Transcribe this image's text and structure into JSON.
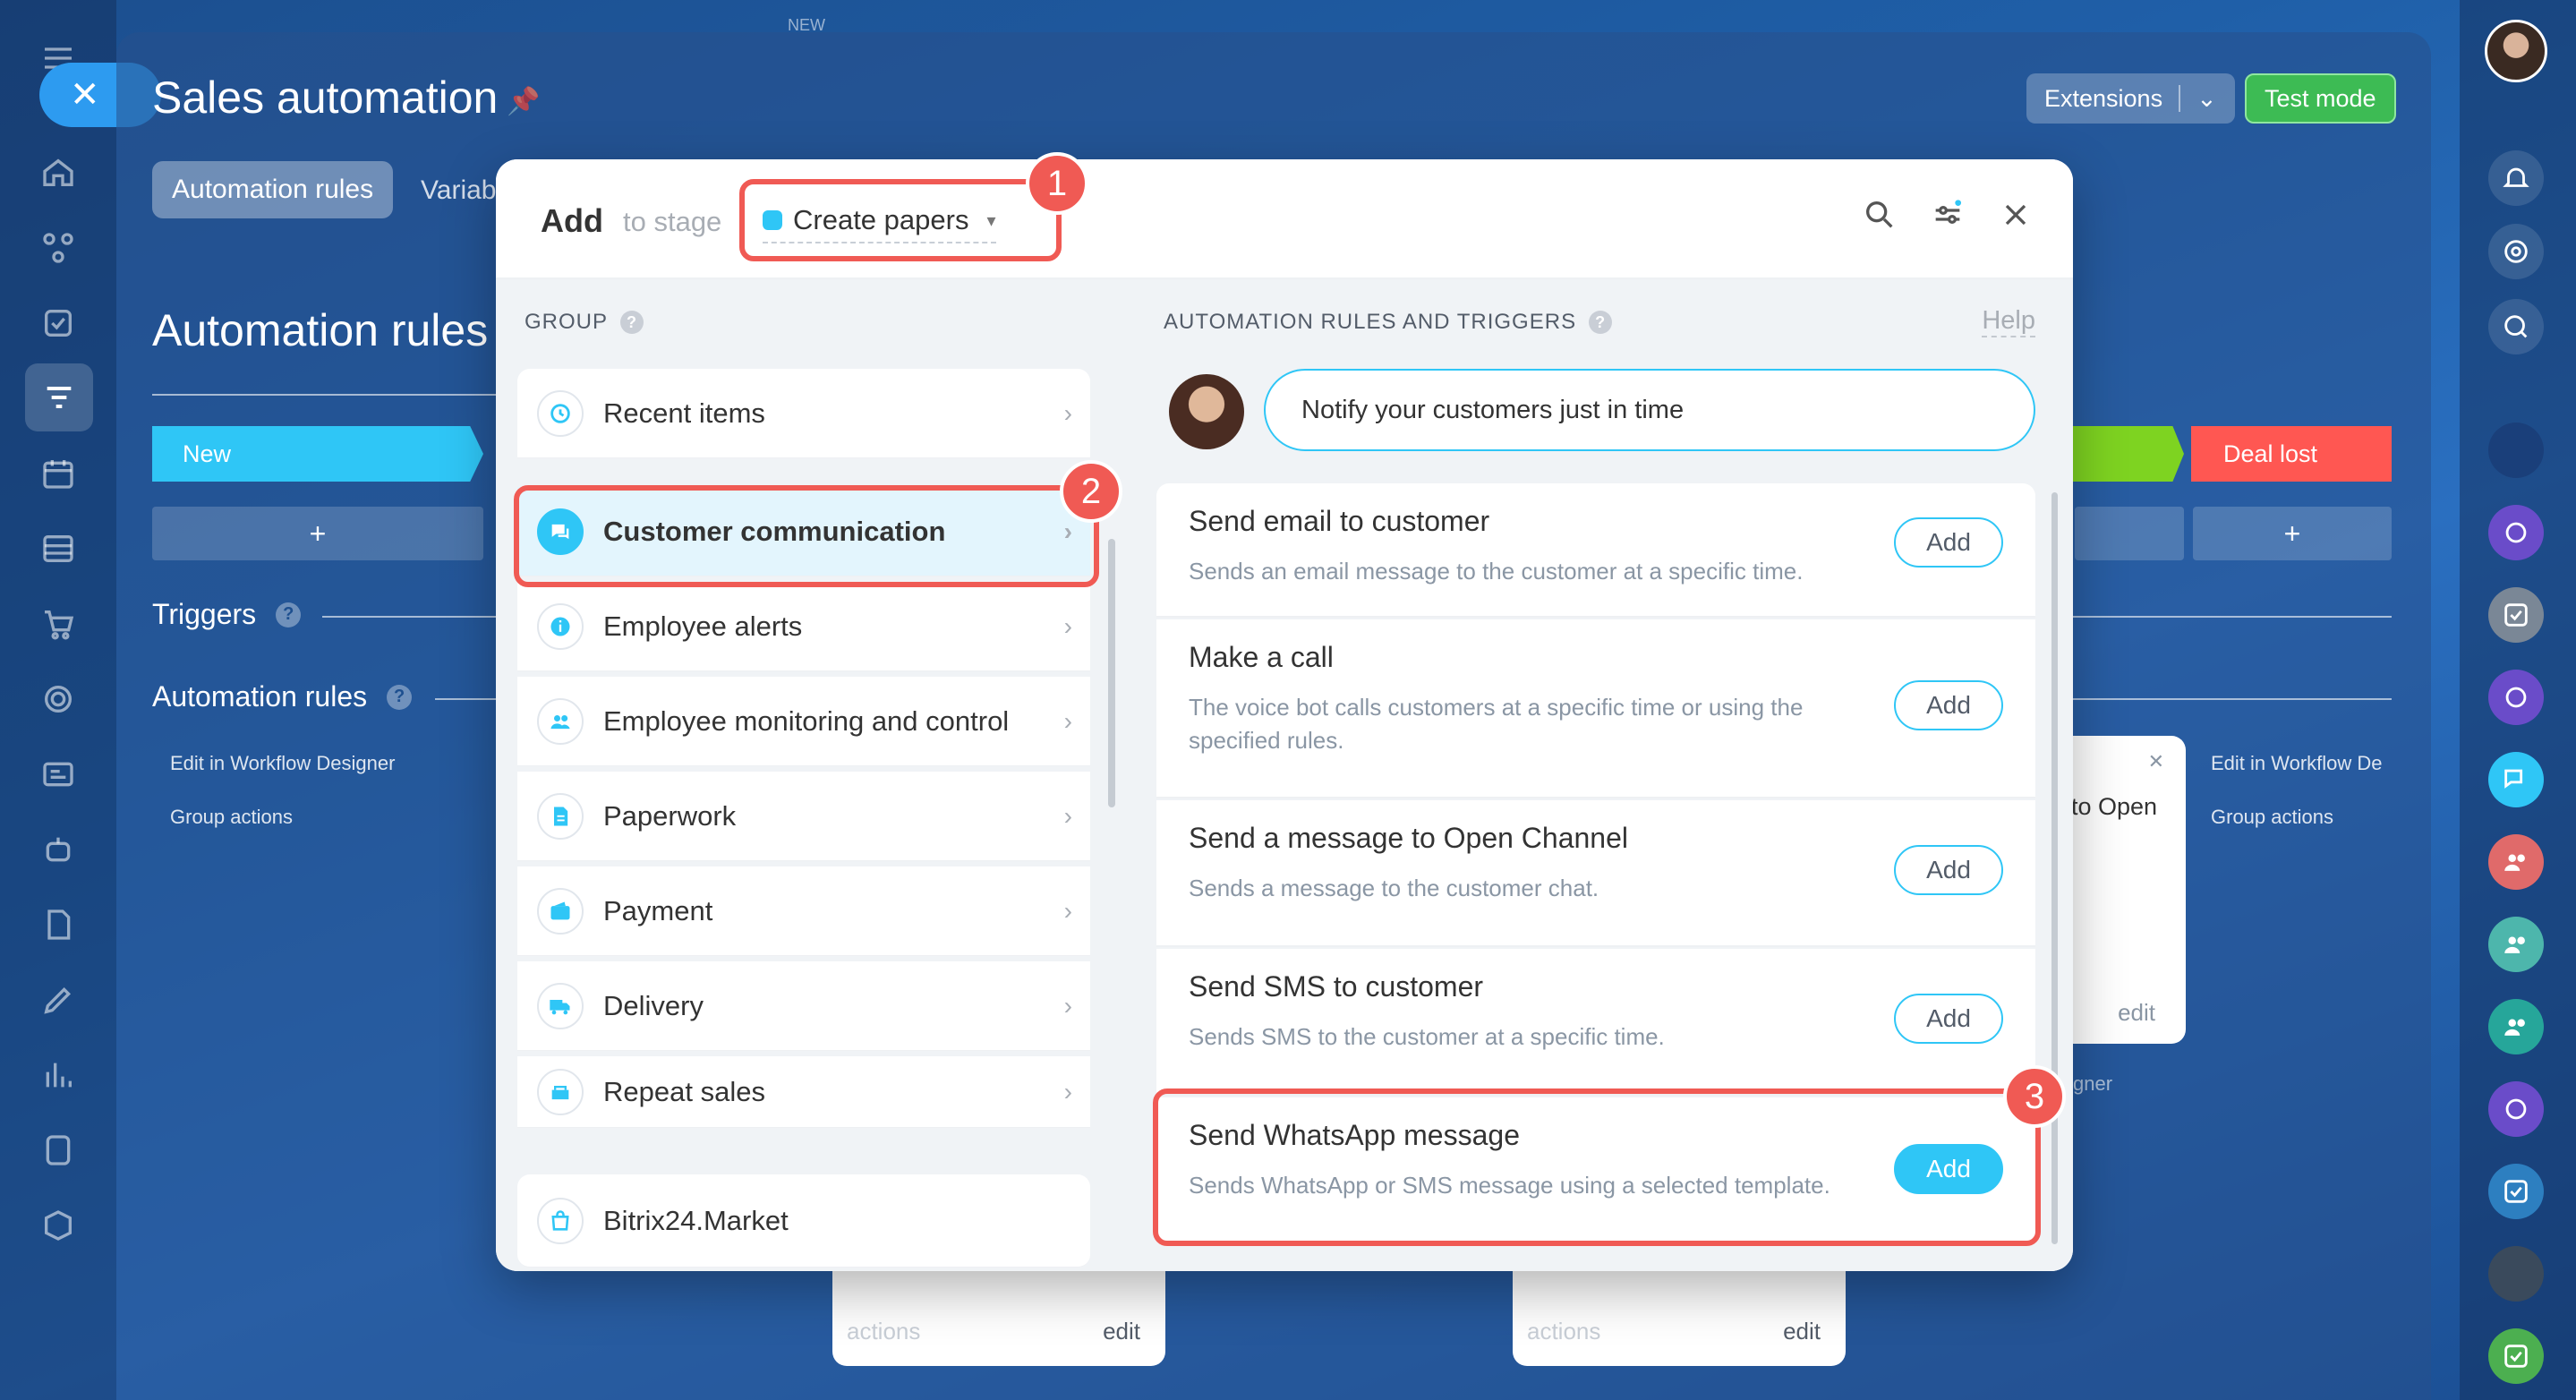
{
  "top_label": "NEW",
  "page": {
    "title": "Sales automation",
    "tabs": [
      "Automation rules",
      "Variab"
    ],
    "extensions_label": "Extensions",
    "test_mode_label": "Test mode",
    "section_title": "Automation rules",
    "stage_new": "New",
    "stage_lost": "Deal lost",
    "plus": "+",
    "triggers_label": "Triggers",
    "rules_label": "Automation rules",
    "edit_workflow": "Edit in Workflow Designer",
    "edit_workflow_right": "Edit in Workflow De",
    "group_actions": "Group actions",
    "card_to_open": "to Open",
    "card_edit": "edit",
    "card_actions": "actions",
    "card_gner": "gner"
  },
  "modal": {
    "add": "Add",
    "to_stage": "to stage",
    "stage_name": "Create papers",
    "group_label": "GROUP",
    "groups": [
      {
        "label": "Recent items",
        "icon": "clock-icon"
      },
      {
        "label": "Customer communication",
        "icon": "chat-icon",
        "selected": true
      },
      {
        "label": "Employee alerts",
        "icon": "info-icon"
      },
      {
        "label": "Employee monitoring and control",
        "icon": "users-icon"
      },
      {
        "label": "Paperwork",
        "icon": "document-icon"
      },
      {
        "label": "Payment",
        "icon": "wallet-icon"
      },
      {
        "label": "Delivery",
        "icon": "truck-icon"
      },
      {
        "label": "Repeat sales",
        "icon": "repeat-icon"
      }
    ],
    "market": "Bitrix24.Market",
    "rules_label": "AUTOMATION RULES AND TRIGGERS",
    "help": "Help",
    "bubble": "Notify your customers just in time",
    "rules": [
      {
        "title": "Send email to customer",
        "desc": "Sends an email message to the customer at a specific time.",
        "add": "Add"
      },
      {
        "title": "Make a call",
        "desc": "The voice bot calls customers at a specific time or using the specified rules.",
        "add": "Add"
      },
      {
        "title": "Send a message to Open Channel",
        "desc": "Sends a message to the customer chat.",
        "add": "Add"
      },
      {
        "title": "Send SMS to customer",
        "desc": "Sends SMS to the customer at a specific time.",
        "add": "Add"
      },
      {
        "title": "Send WhatsApp message",
        "desc": "Sends WhatsApp or SMS message using a selected template.",
        "add": "Add"
      }
    ]
  },
  "annotations": [
    "1",
    "2",
    "3"
  ],
  "colors": {
    "accent": "#2fc6f6",
    "highlight": "#f05a54",
    "test_mode": "#3dbb54",
    "deal_lost": "#ff5752"
  }
}
